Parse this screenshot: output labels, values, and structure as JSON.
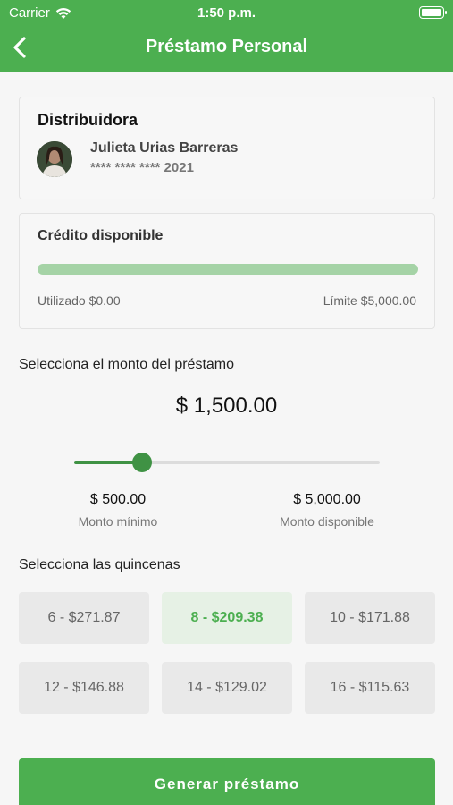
{
  "status_bar": {
    "carrier": "Carrier",
    "time": "1:50 p.m."
  },
  "nav": {
    "title": "Préstamo Personal"
  },
  "distributor": {
    "label": "Distribuidora",
    "name": "Julieta Urias Barreras",
    "card_number": "**** **** **** 2021"
  },
  "credit": {
    "label": "Crédito disponible",
    "used": "Utilizado $0.00",
    "limit": "Límite $5,000.00",
    "available_fraction": 1.0
  },
  "loan": {
    "section_label": "Selecciona el monto del préstamo",
    "amount": "$ 1,500.00",
    "slider_fraction": 0.222,
    "min_value": "$ 500.00",
    "min_label": "Monto mínimo",
    "max_value": "$ 5,000.00",
    "max_label": "Monto disponible"
  },
  "installments": {
    "section_label": "Selecciona las quincenas",
    "options": [
      {
        "label": "6 - $271.87",
        "selected": false
      },
      {
        "label": "8 - $209.38",
        "selected": true
      },
      {
        "label": "10 - $171.88",
        "selected": false
      },
      {
        "label": "12 - $146.88",
        "selected": false
      },
      {
        "label": "14 - $129.02",
        "selected": false
      },
      {
        "label": "16 - $115.63",
        "selected": false
      }
    ]
  },
  "cta": {
    "label": "Generar préstamo"
  },
  "colors": {
    "primary": "#4caf50",
    "slider": "#3f9244",
    "credit_bar": "#a5d3a6"
  }
}
